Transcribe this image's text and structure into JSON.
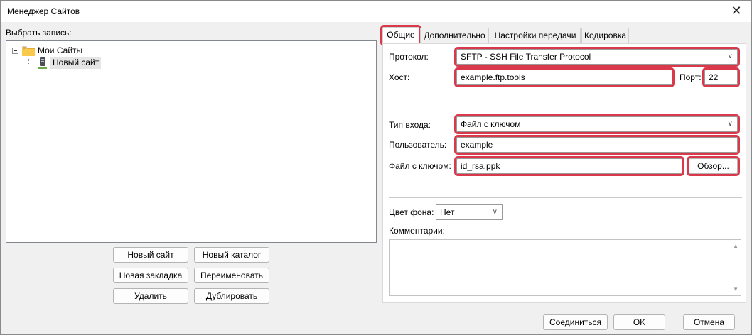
{
  "window": {
    "title": "Менеджер Сайтов"
  },
  "left": {
    "select_label": "Выбрать запись:",
    "tree": {
      "root": "Мои Сайты",
      "child": "Новый сайт"
    },
    "buttons": {
      "new_site": "Новый сайт",
      "new_folder": "Новый каталог",
      "new_bookmark": "Новая закладка",
      "rename": "Переименовать",
      "delete": "Удалить",
      "duplicate": "Дублировать"
    }
  },
  "tabs": [
    "Общие",
    "Дополнительно",
    "Настройки передачи",
    "Кодировка"
  ],
  "general": {
    "protocol_label": "Протокол:",
    "protocol_value": "SFTP - SSH File Transfer Protocol",
    "host_label": "Хост:",
    "host_value": "example.ftp.tools",
    "port_label": "Порт:",
    "port_value": "22",
    "logon_label": "Тип входа:",
    "logon_value": "Файл с ключом",
    "user_label": "Пользователь:",
    "user_value": "example",
    "keyfile_label": "Файл с ключом:",
    "keyfile_value": "id_rsa.ppk",
    "browse": "Обзор...",
    "bg_label": "Цвет фона:",
    "bg_value": "Нет",
    "comments_label": "Комментарии:"
  },
  "footer": {
    "connect": "Соединиться",
    "ok": "OK",
    "cancel": "Отмена"
  },
  "colors": {
    "highlight": "#d9394a"
  },
  "icons": [
    "close-icon",
    "folder-icon",
    "server-icon",
    "chevron-down-icon",
    "scroll-up-icon",
    "scroll-down-icon",
    "tree-collapse-icon"
  ]
}
